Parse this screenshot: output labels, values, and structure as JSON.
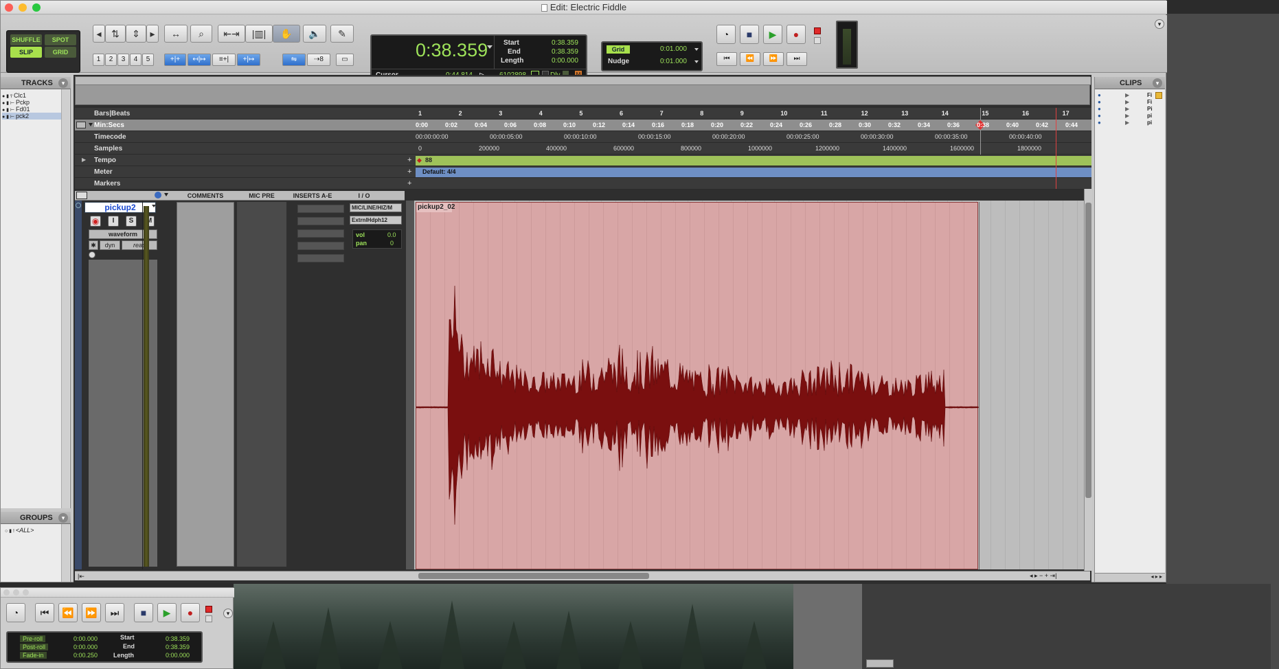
{
  "window": {
    "title": "Edit: Electric Fiddle"
  },
  "modes": {
    "shuffle": "SHUFFLE",
    "spot": "SPOT",
    "slip": "SLIP",
    "grid": "GRID"
  },
  "zoom_presets": [
    "1",
    "2",
    "3",
    "4",
    "5"
  ],
  "counter": {
    "main": "0:38.359",
    "start_label": "Start",
    "start": "0:38.359",
    "end_label": "End",
    "end": "0:38.359",
    "length_label": "Length",
    "length": "0:00.000",
    "cursor_label": "Cursor",
    "cursor": "0:44.814",
    "sample": "6102898",
    "dly": "Dly"
  },
  "grid": {
    "label": "Grid",
    "value": "0:01.000"
  },
  "nudge": {
    "label": "Nudge",
    "value": "0:01.000"
  },
  "tracks_panel": {
    "title": "TRACKS",
    "items": [
      "Clc1",
      "Pckp",
      "Fd01",
      "pck2"
    ]
  },
  "groups_panel": {
    "title": "GROUPS",
    "all": "<ALL>"
  },
  "clips_panel": {
    "title": "CLIPS",
    "items": [
      "Fi",
      "Fi",
      "Pi",
      "pi",
      "pi"
    ]
  },
  "rulers": {
    "bars_beats": "Bars|Beats",
    "min_secs": "Min:Secs",
    "timecode": "Timecode",
    "samples": "Samples",
    "tempo": "Tempo",
    "meter": "Meter",
    "markers": "Markers",
    "bars": [
      "1",
      "2",
      "3",
      "4",
      "5",
      "6",
      "7",
      "8",
      "9",
      "10",
      "11",
      "12",
      "13",
      "14",
      "15",
      "16",
      "17"
    ],
    "minsecs": [
      "0:00",
      "0:02",
      "0:04",
      "0:06",
      "0:08",
      "0:10",
      "0:12",
      "0:14",
      "0:16",
      "0:18",
      "0:20",
      "0:22",
      "0:24",
      "0:26",
      "0:28",
      "0:30",
      "0:32",
      "0:34",
      "0:36",
      "0:38",
      "0:40",
      "0:42",
      "0:44"
    ],
    "timecodes": [
      "00:00:00:00",
      "00:00:05:00",
      "00:00:10:00",
      "00:00:15:00",
      "00:00:20:00",
      "00:00:25:00",
      "00:00:30:00",
      "00:00:35:00",
      "00:00:40:00"
    ],
    "samples_vals": [
      "0",
      "200000",
      "400000",
      "600000",
      "800000",
      "1000000",
      "1200000",
      "1400000",
      "1600000",
      "1800000"
    ],
    "tempo_value": "88",
    "meter_value": "Default: 4/4"
  },
  "columns": {
    "comments": "COMMENTS",
    "mic_pre": "MIC PRE",
    "inserts": "INSERTS A-E",
    "io": "I / O"
  },
  "track": {
    "name": "pickup2",
    "view": "waveform",
    "dyn": "dyn",
    "automation": "read",
    "input": "MIC/LINE/HIZ/M",
    "output": "ExtrnlHdph12",
    "vol_label": "vol",
    "vol": "0.0",
    "pan_label": "pan",
    "pan": "0"
  },
  "clip": {
    "name": "pickup2_02"
  },
  "transport": {
    "preroll_label": "Pre-roll",
    "preroll": "0:00.000",
    "postroll_label": "Post-roll",
    "postroll": "0:00.000",
    "fadein_label": "Fade-in",
    "fadein": "0:00.250",
    "start_label": "Start",
    "start": "0:38.359",
    "end_label": "End",
    "end": "0:38.359",
    "length_label": "Length",
    "length": "0:00.000"
  },
  "colors": {
    "counter_green": "#9ee35a",
    "clip_bg": "#d8a6a6",
    "waveform": "#7a0f0f",
    "tempo_ruler": "#9fc25a",
    "meter_ruler": "#6e8fc4"
  }
}
